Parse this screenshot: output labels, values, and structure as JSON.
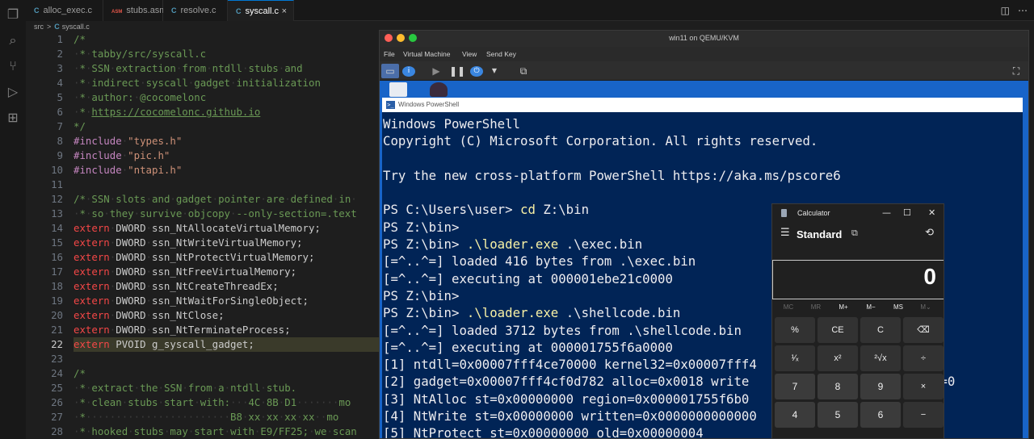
{
  "editor": {
    "tabs": [
      {
        "label": "alloc_exec.c",
        "icon": "C",
        "icon_color": "#519aba"
      },
      {
        "label": "stubs.asm",
        "icon": "ASM",
        "icon_color": "#e45649"
      },
      {
        "label": "resolve.c",
        "icon": "C",
        "icon_color": "#519aba"
      },
      {
        "label": "syscall.c",
        "icon": "C",
        "icon_color": "#519aba",
        "close": "×"
      }
    ],
    "breadcrumb": {
      "folder": "src",
      "sep": ">",
      "icon": "C",
      "file": "syscall.c"
    },
    "current_line": 22,
    "line_numbers": [
      "1",
      "2",
      "3",
      "4",
      "5",
      "6",
      "7",
      "8",
      "9",
      "10",
      "11",
      "12",
      "13",
      "14",
      "15",
      "16",
      "17",
      "18",
      "19",
      "20",
      "21",
      "22",
      "23",
      "24",
      "25",
      "26",
      "27",
      "28"
    ]
  },
  "vm": {
    "title": "win11 on QEMU/KVM",
    "menu": [
      "File",
      "Virtual Machine",
      "View",
      "Send Key"
    ],
    "traffic_light_colors": [
      "#ff5f57",
      "#febc2e",
      "#28c840"
    ]
  },
  "powershell": {
    "window_title": "Windows PowerShell",
    "lines": [
      {
        "text": "Windows PowerShell"
      },
      {
        "text": "Copyright (C) Microsoft Corporation. All rights reserved."
      },
      {
        "text": ""
      },
      {
        "text": "Try the new cross-platform PowerShell https://aka.ms/pscore6"
      },
      {
        "text": ""
      },
      {
        "prompt": "PS C:\\Users\\user> ",
        "cmd": "cd",
        "rest": " Z:\\bin"
      },
      {
        "text": "PS Z:\\bin>"
      },
      {
        "prompt": "PS Z:\\bin> ",
        "cmd": ".\\loader.exe",
        "rest": " .\\exec.bin"
      },
      {
        "text": "[=^..^=] loaded 416 bytes from .\\exec.bin"
      },
      {
        "text": "[=^..^=] executing at 000001ebe21c0000"
      },
      {
        "text": "PS Z:\\bin>"
      },
      {
        "prompt": "PS Z:\\bin> ",
        "cmd": ".\\loader.exe",
        "rest": " .\\shellcode.bin"
      },
      {
        "text": "[=^..^=] loaded 3712 bytes from .\\shellcode.bin"
      },
      {
        "text": "[=^..^=] executing at 000001755f6a0000"
      },
      {
        "text": "[1] ntdll=0x00007fff4ce70000 kernel32=0x00007fff4"
      },
      {
        "text": "[2] gadget=0x00007fff4cf0d782 alloc=0x0018 write                 0 thread=0"
      },
      {
        "text": "[3] NtAlloc st=0x00000000 region=0x000001755f6b0                  001000"
      },
      {
        "text": "[4] NtWrite st=0x00000000 written=0x0000000000000"
      },
      {
        "text": "[5] NtProtect st=0x00000000 old=0x00000004"
      }
    ]
  },
  "calculator": {
    "title": "Calculator",
    "mode": "Standard",
    "display": "0",
    "window_controls": [
      "—",
      "☐",
      "✕"
    ],
    "memory_keys": [
      {
        "label": "MC",
        "enabled": false
      },
      {
        "label": "MR",
        "enabled": false
      },
      {
        "label": "M+",
        "enabled": true
      },
      {
        "label": "M−",
        "enabled": true
      },
      {
        "label": "MS",
        "enabled": true
      },
      {
        "label": "M⌄",
        "enabled": false
      }
    ],
    "keys": [
      [
        "%",
        "CE",
        "C",
        "⌫"
      ],
      [
        "¹⁄ₓ",
        "x²",
        "²√x",
        "÷"
      ],
      [
        "7",
        "8",
        "9",
        "×"
      ],
      [
        "4",
        "5",
        "6",
        "−"
      ]
    ]
  }
}
